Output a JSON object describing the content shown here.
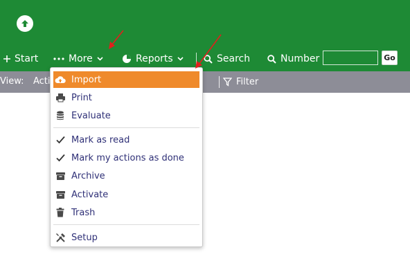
{
  "nav": {
    "start_label": "Start",
    "more_label": "More",
    "reports_label": "Reports",
    "search_label": "Search",
    "number_label": "Number",
    "number_value": "",
    "go_label": "Go"
  },
  "toolbar": {
    "view_label": "View:",
    "view_value": "Acti",
    "filter_label": "Filter"
  },
  "menu": {
    "items": [
      {
        "label": "Import",
        "icon": "cloud-upload-icon",
        "active": true
      },
      {
        "label": "Print",
        "icon": "printer-icon"
      },
      {
        "label": "Evaluate",
        "icon": "database-icon"
      },
      {
        "label": "Mark as read",
        "icon": "checkmark-icon"
      },
      {
        "label": "Mark my actions as done",
        "icon": "checkmark-icon"
      },
      {
        "label": "Archive",
        "icon": "archive-box-icon"
      },
      {
        "label": "Activate",
        "icon": "archive-box-icon"
      },
      {
        "label": "Trash",
        "icon": "trash-icon"
      },
      {
        "label": "Setup",
        "icon": "tools-icon"
      }
    ]
  },
  "colors": {
    "header": "#1e8a35",
    "toolbar": "#8d8d97",
    "menu_active": "#ef8a2b",
    "menu_text": "#2f3077",
    "annotation_arrow": "#e0201c"
  }
}
